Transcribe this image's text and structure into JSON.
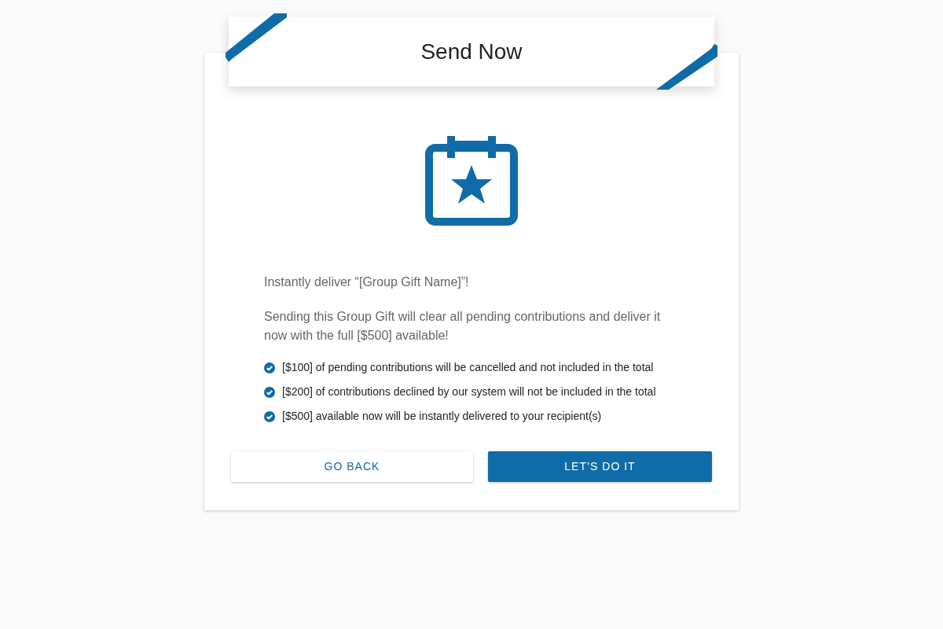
{
  "title": "Send Now",
  "intro": "Instantly deliver “[Group Gift Name]”!",
  "description": "Sending this Group Gift will clear all pending contributions and deliver it now with the full [$500] available!",
  "points": [
    {
      "text": "[$100] of pending contributions will be cancelled and not included in the total"
    },
    {
      "text": "[$200] of contributions declined by our system will not be included in the total"
    },
    {
      "text": "[$500] available now will be instantly delivered to your recipient(s)"
    }
  ],
  "buttons": [
    {
      "label": "GO BACK",
      "kind": "secondary"
    },
    {
      "label": "LET’S DO IT",
      "kind": "primary"
    }
  ]
}
